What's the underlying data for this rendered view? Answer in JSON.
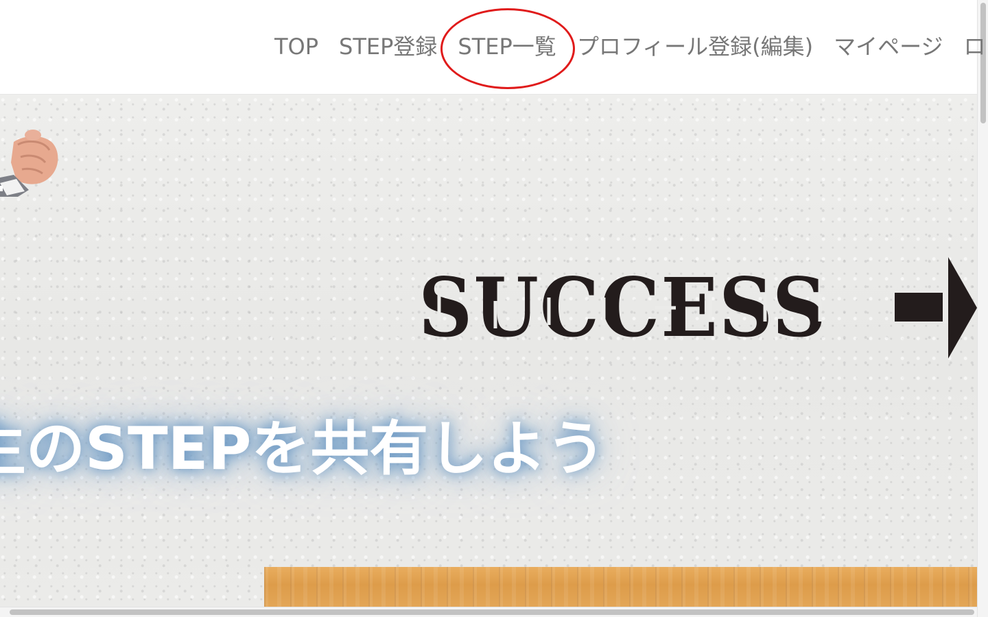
{
  "nav": {
    "items": [
      {
        "label": "TOP"
      },
      {
        "label": "STEP登録"
      },
      {
        "label": "STEP一覧",
        "highlighted": true
      },
      {
        "label": "プロフィール登録(編集)"
      },
      {
        "label": "マイページ"
      },
      {
        "label": "ロ"
      }
    ],
    "text_color": "#777777",
    "highlight_color": "#e01b1b"
  },
  "hero": {
    "image_word": "SUCCESS",
    "tagline": "生のSTEPを共有しよう",
    "icons": [
      "pointing-hand-icon",
      "right-arrow-icon"
    ]
  }
}
